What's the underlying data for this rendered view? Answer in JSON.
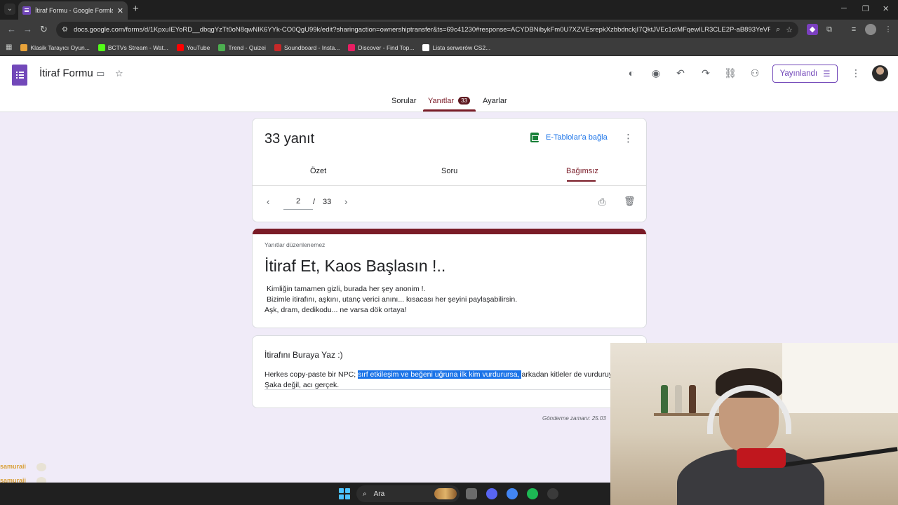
{
  "browser": {
    "tab_title": "İtiraf Formu - Google Formlar",
    "url": "docs.google.com/forms/d/1KpxuIEYoRD__dbqgYzTt0oN8qwNIK6YYk-CO0QgU99k/edit?sharingaction=ownershiptransfer&ts=69c41230#response=ACYDBNibykFm0U7XZVEsrepkXzbbdnckjI7QktJVEc1ctMFqewILR3CLE2P-aB893YeVPZo",
    "bookmarks": [
      {
        "label": "Klasik Tarayıcı Oyun...",
        "color": "#e8a33a"
      },
      {
        "label": "BCTVs Stream - Wat...",
        "color": "#53fc18"
      },
      {
        "label": "YouTube",
        "color": "#ff0000"
      },
      {
        "label": "Trend - Quizei",
        "color": "#4caf50"
      },
      {
        "label": "Soundboard - Insta...",
        "color": "#c62828"
      },
      {
        "label": "Discover - Find Top...",
        "color": "#e91e63"
      },
      {
        "label": "Lista serwerów CS2...",
        "color": "#ffffff"
      }
    ]
  },
  "forms_header": {
    "title": "İtiraf Formu",
    "publish_label": "Yayınlandı",
    "tabs": [
      {
        "label": "Sorular"
      },
      {
        "label": "Yanıtlar",
        "badge": "33"
      },
      {
        "label": "Ayarlar"
      }
    ]
  },
  "summary": {
    "count_label": "33 yanıt",
    "sheets_label": "E-Tablolar'a bağla",
    "sub_tabs": [
      "Özet",
      "Soru",
      "Bağımsız"
    ],
    "pager": {
      "current": "2",
      "separator": "/",
      "total": "33"
    }
  },
  "form_header": {
    "not_editable": "Yanıtlar düzenlenemez",
    "title": "İtiraf Et, Kaos Başlasın !..",
    "description_lines": [
      "Kimliğin tamamen gizli, burada her şey anonim !.",
      "Bizimle itirafını, aşkını, utanç verici anını... kısacası her şeyini paylaşabilirsin.",
      "Aşk, dram, dedikodu... ne varsa dök ortaya!"
    ]
  },
  "answer_card": {
    "question": "İtirafını Buraya Yaz :)",
    "answer_before": "Herkes copy-paste bir NPC; ",
    "answer_highlight": "sırf etkileşim ve beğeni uğruna ilk kim vurdurursa, ",
    "answer_after": "arkadan kitleler de vurduruy",
    "answer_line2": "Şaka değil, acı gerçek.",
    "submitted": "Gönderme zamanı: 25.03"
  },
  "taskbar": {
    "search_label": "Ara",
    "apps": [
      {
        "name": "file-explorer",
        "color": "#6b6b6b"
      },
      {
        "name": "discord",
        "color": "#5865f2"
      },
      {
        "name": "chrome",
        "color": "#4285f4"
      },
      {
        "name": "spotify",
        "color": "#1db954"
      },
      {
        "name": "steam",
        "color": "#3a3a3a"
      }
    ]
  },
  "stream_overlay": {
    "chat_names": [
      "samuraii",
      "samuraii",
      "samuraii"
    ]
  },
  "colors": {
    "forms_accent": "#7248b9",
    "form_theme": "#7a1b27",
    "page_bg": "#f0ebf8",
    "link_blue": "#1a73e8",
    "highlight": "#1a73e8"
  }
}
